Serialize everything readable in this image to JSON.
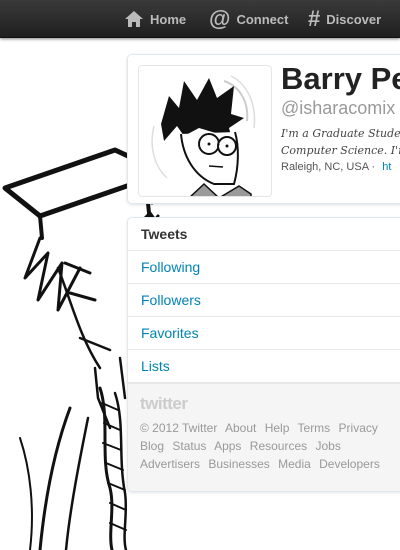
{
  "topbar": {
    "items": [
      {
        "label": "Home",
        "icon": "home-icon"
      },
      {
        "label": "Connect",
        "icon": "at-icon"
      },
      {
        "label": "Discover",
        "icon": "hash-icon"
      }
    ]
  },
  "profile": {
    "name": "Barry Pe",
    "handle": "@isharacomix",
    "bio_line1": "I'm a Graduate Studen",
    "bio_line2": "Computer Science. I'm",
    "location": "Raleigh, NC, USA",
    "location_separator": "·",
    "link_fragment": "ht"
  },
  "sidenav": {
    "items": [
      {
        "label": "Tweets"
      },
      {
        "label": "Following"
      },
      {
        "label": "Followers"
      },
      {
        "label": "Favorites"
      },
      {
        "label": "Lists"
      }
    ]
  },
  "footer": {
    "wordmark": "twitter",
    "copyright": "© 2012 Twitter",
    "links": [
      "About",
      "Help",
      "Terms",
      "Privacy",
      "Blog",
      "Status",
      "Apps",
      "Resources",
      "Jobs",
      "Advertisers",
      "Businesses",
      "Media",
      "Developers"
    ]
  },
  "colors": {
    "topbar": "#2a2a2a",
    "topbar_text": "#bbbbbb",
    "link": "#0084b4",
    "muted": "#999999"
  }
}
